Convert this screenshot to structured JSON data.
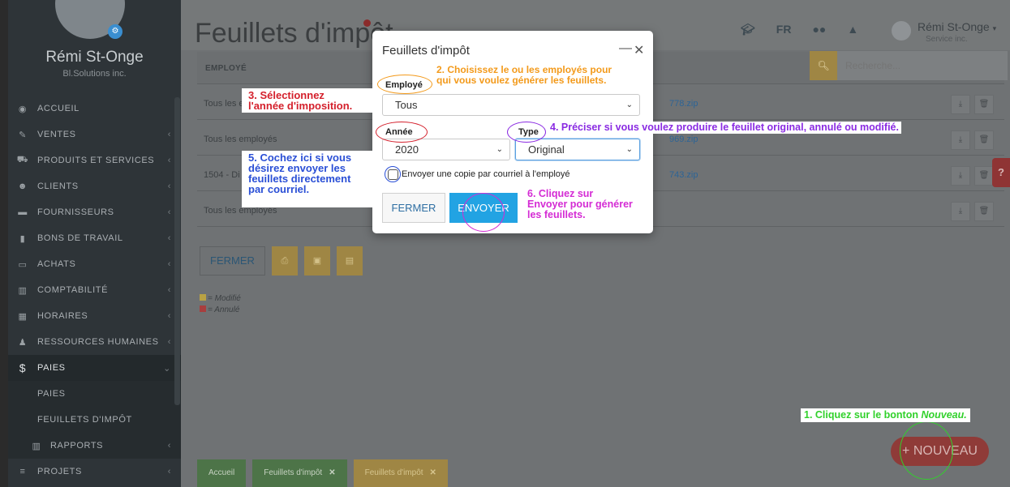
{
  "sidebar": {
    "user_name": "Rémi St-Onge",
    "user_company": "Bl.Solutions inc.",
    "menu": [
      {
        "label": "ACCUEIL",
        "icon": "dashboard-icon",
        "glyph": "◉",
        "chevron": false
      },
      {
        "label": "VENTES",
        "icon": "edit-icon",
        "glyph": "✎",
        "chevron": true
      },
      {
        "label": "PRODUITS ET SERVICES",
        "icon": "cart-icon",
        "glyph": "⛟",
        "chevron": true
      },
      {
        "label": "CLIENTS",
        "icon": "users-icon",
        "glyph": "☻",
        "chevron": true
      },
      {
        "label": "FOURNISSEURS",
        "icon": "truck-icon",
        "glyph": "▬",
        "chevron": true
      },
      {
        "label": "BONS DE TRAVAIL",
        "icon": "document-icon",
        "glyph": "▮",
        "chevron": true
      },
      {
        "label": "ACHATS",
        "icon": "credit-card-icon",
        "glyph": "▭",
        "chevron": true
      },
      {
        "label": "COMPTABILITÉ",
        "icon": "bar-chart-icon",
        "glyph": "▥",
        "chevron": true
      },
      {
        "label": "HORAIRES",
        "icon": "calendar-icon",
        "glyph": "▦",
        "chevron": true
      },
      {
        "label": "RESSOURCES HUMAINES",
        "icon": "person-icon",
        "glyph": "♟",
        "chevron": true
      },
      {
        "label": "PAIES",
        "icon": "dollar-icon",
        "glyph": "$",
        "chevron": true,
        "active": true
      },
      {
        "label": "PAIES",
        "sub": true
      },
      {
        "label": "FEUILLETS D'IMPÔT",
        "sub": true
      },
      {
        "label": "RAPPORTS",
        "sub": true,
        "icon": "bar-chart-icon",
        "glyph": "▥",
        "chevron": true
      },
      {
        "label": "PROJETS",
        "icon": "list-icon",
        "glyph": "≡",
        "chevron": true
      }
    ]
  },
  "header": {
    "page_title": "Feuillets d'impôt",
    "lang": "FR",
    "user_name": "Rémi St-Onge",
    "user_company": "Service inc."
  },
  "search": {
    "placeholder": "Recherche..."
  },
  "table": {
    "column_employee": "EMPLOYÉ",
    "rows": [
      {
        "employee": "Tous les e",
        "file": "778.zip"
      },
      {
        "employee": "Tous les employés",
        "file": "969.zip"
      },
      {
        "employee": "1504 - Di",
        "file": "743.zip"
      },
      {
        "employee": "Tous les employés",
        "file": ""
      }
    ]
  },
  "actions": {
    "close_label": "FERMER"
  },
  "legend": {
    "modified": "= Modifié",
    "cancelled": "= Annulé",
    "modified_color": "#b9a244",
    "cancelled_color": "#a83e3e"
  },
  "fab": {
    "label": "+ NOUVEAU"
  },
  "tabs": [
    {
      "label": "Accueil",
      "close": false,
      "color": "green"
    },
    {
      "label": "Feuillets d'impôt",
      "close": true,
      "color": "green"
    },
    {
      "label": "Feuillets d'impôt",
      "close": true,
      "color": "yellow"
    }
  ],
  "modal": {
    "title": "Feuillets d'impôt",
    "employee_label": "Employé",
    "employee_value": "Tous",
    "year_label": "Année",
    "year_value": "2020",
    "type_label": "Type",
    "type_value": "Original",
    "checkbox_label": "Envoyer une copie par courriel à l'employé",
    "close_label": "FERMER",
    "send_label": "ENVOYER"
  },
  "annotations": {
    "step1_prefix": "1. Cliquez sur le bonton ",
    "step1_emph": "Nouveau.",
    "step2_line1": "2. Choisissez le ou les employés pour",
    "step2_line2": "qui vous voulez générer les feuillets.",
    "step3_line1": "3. Sélectionnez",
    "step3_line2": "l'année d'imposition.",
    "step4": "4. Préciser si vous voulez produire le feuillet original, annulé ou modifié.",
    "step5_line1": "5. Cochez ici si vous",
    "step5_line2": "désirez envoyer les",
    "step5_line3": "feuillets directement",
    "step5_line4": "par courriel.",
    "step6_line1": "6. Cliquez sur",
    "step6_line2": "Envoyer pour générer",
    "step6_line3": "les feuillets."
  },
  "colors": {
    "step1": "#31d12b",
    "step2": "#f39a1b",
    "step3": "#d4202c",
    "step4": "#8a2be2",
    "step5": "#2a4fd6",
    "step6": "#d42bd4"
  }
}
